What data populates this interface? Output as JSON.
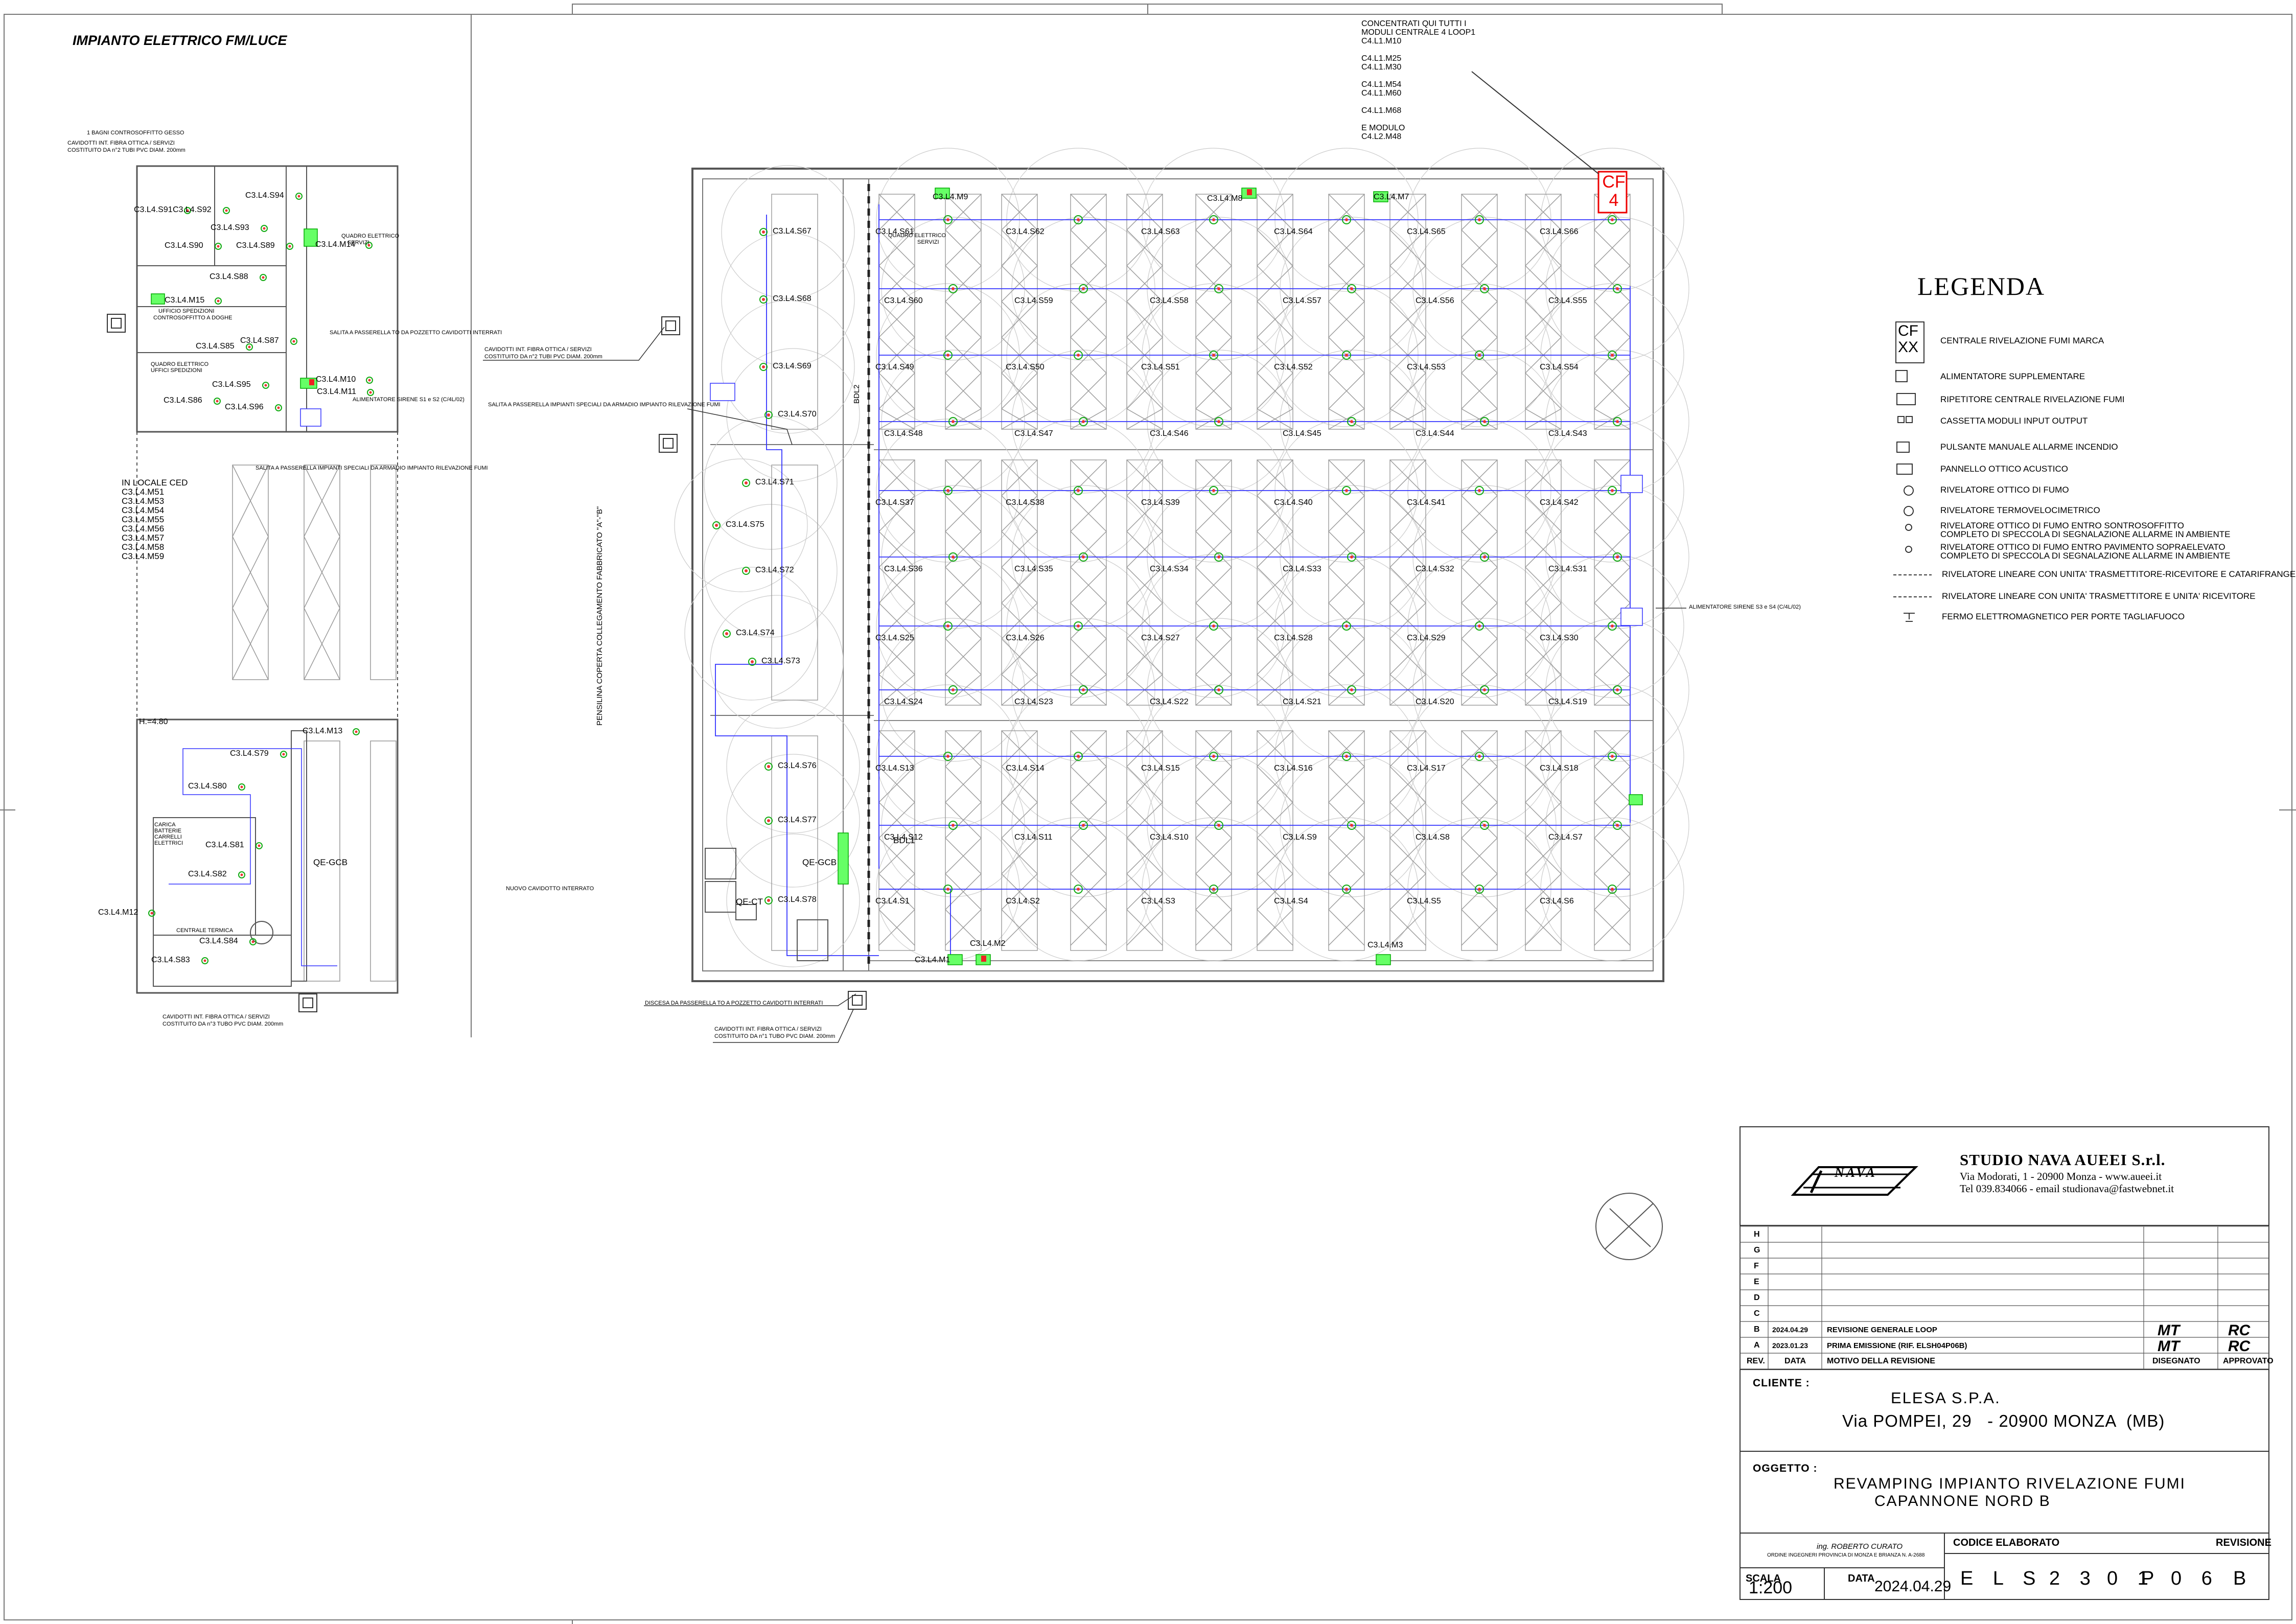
{
  "sheet_title": "IMPIANTO ELETTRICO FM/LUCE",
  "concentrator_note": [
    "CONCENTRATI QUI TUTTI I",
    "MODULI CENTRALE 4 LOOP1",
    "C4.L1.M10",
    "",
    "C4.L1.M25",
    "C4.L1.M30",
    "",
    "C4.L1.M54",
    "C4.L1.M60",
    "",
    "C4.L1.M68",
    "",
    "E MODULO",
    "C4.L2.M48"
  ],
  "central_box": {
    "line1": "CF",
    "line2": "4"
  },
  "left_notes": {
    "bagni": "1 BAGNI CONTROSOFFITTO GESSO",
    "cavidotti_top": [
      "CAVIDOTTI INT. FIBRA OTTICA / SERVIZI",
      "COSTITUITO DA n°2 TUBI PVC DIAM. 200mm"
    ],
    "ufficio_spedizioni": [
      "UFFICIO SPEDIZIONI",
      "CONTROSOFFITTO A DOGHE"
    ],
    "quadro_elettrico_uffici": [
      "QUADRO ELETTRICO",
      "UFFICI SPEDIZIONI"
    ],
    "quadro_elettrico_servizi": [
      "QUADRO ELETTRICO",
      "SERVIZI"
    ],
    "salita_cavidotti": "SALITA A PASSERELLA TO DA POZZETTO CAVIDOTTI INTERRATI",
    "alimentatore_sirene_1": "ALIMENTATORE SIRENE S1 e S2 (C/4L/02)",
    "salita_armadio": "SALITA A PASSERELLA IMPIANTI SPECIALI DA ARMADIO IMPIANTO RILEVAZIONE FUMI",
    "in_locale_ced": [
      "IN LOCALE CED",
      "C3.L4.M51",
      "C3.L4.M53",
      "C3.L4.M54",
      "C3.L4.M55",
      "C3.L4.M56",
      "C3.L4.M57",
      "C3.L4.M58",
      "C3.L4.M59"
    ],
    "height": "H.=4.80",
    "carica_batterie": [
      "CARICA",
      "BATTERIE",
      "CARRELLI",
      "ELETTRICI"
    ],
    "centrale_termica": "CENTRALE TERMICA",
    "cavidotti_bottom": [
      "CAVIDOTTI INT. FIBRA OTTICA / SERVIZI",
      "COSTITUITO DA n°3 TUBO PVC DIAM. 200mm"
    ],
    "qe_gcb_left": "QE-GCB"
  },
  "middle_notes": {
    "cavidotti_mid": [
      "CAVIDOTTI INT. FIBRA OTTICA / SERVIZI",
      "COSTITUITO DA n°2 TUBI PVC DIAM. 200mm"
    ],
    "salita_rilevazione": "SALITA A PASSERELLA IMPIANTI SPECIALI DA ARMADIO IMPIANTO RILEVAZIONE FUMI",
    "pensilina": "PENSILINA COPERTA COLLEGAMENTO FABBRICATO \"A\"-\"B\"",
    "nuovo_cavidotto": "NUOVO CAVIDOTTO INTERRATO",
    "discesa": "DISCESA DA PASSERELLA TO A POZZETTO CAVIDOTTI INTERRATI",
    "cavidotti_low": [
      "CAVIDOTTI INT. FIBRA OTTICA / SERVIZI",
      "COSTITUITO DA n°1 TUBO PVC DIAM. 200mm"
    ],
    "alimentatore_sirene_2": "ALIMENTATORE SIRENE S3 e S4 (C/4L/02)",
    "bdl1": "BDL1",
    "bdl2": "BDL2",
    "qe_gcb": "QE-GCB",
    "qe_ct": "QE-CT",
    "quadro_servizi": [
      "QUADRO ELETTRICO",
      "SERVIZI"
    ]
  },
  "left_labels": [
    "C3.L4.S91",
    "C3.L4.S92",
    "C3.L4.S94",
    "C3.L4.S93",
    "C3.L4.S90",
    "C3.L4.S89",
    "C3.L4.M14",
    "C3.L4.S88",
    "C3.L4.M15",
    "C3.L4.S87",
    "C3.L4.S85",
    "C3.L4.S95",
    "C3.L4.M10",
    "C3.L4.M11",
    "C3.L4.S86",
    "C3.L4.S96",
    "C3.L4.M13",
    "C3.L4.S79",
    "C3.L4.S80",
    "C3.L4.S81",
    "C3.L4.S82",
    "C3.L4.M12",
    "C3.L4.S84",
    "C3.L4.S83"
  ],
  "mid_labels": [
    "C3.L4.S67",
    "C3.L4.S68",
    "C3.L4.S69",
    "C3.L4.S70",
    "C3.L4.S71",
    "C3.L4.S75",
    "C3.L4.S72",
    "C3.L4.S74",
    "C3.L4.S73",
    "C3.L4.S76",
    "C3.L4.S77",
    "C3.L4.S78"
  ],
  "main_grid": {
    "row1": [
      "C3.L4.S61",
      "C3.L4.S62",
      "C3.L4.S63",
      "C3.L4.S64",
      "C3.L4.S65",
      "C3.L4.S66"
    ],
    "row2": [
      "C3.L4.S60",
      "C3.L4.S59",
      "C3.L4.S58",
      "C3.L4.S57",
      "C3.L4.S56",
      "C3.L4.S55"
    ],
    "row3": [
      "C3.L4.S49",
      "C3.L4.S50",
      "C3.L4.S51",
      "C3.L4.S52",
      "C3.L4.S53",
      "C3.L4.S54"
    ],
    "row4": [
      "C3.L4.S48",
      "C3.L4.S47",
      "C3.L4.S46",
      "C3.L4.S45",
      "C3.L4.S44",
      "C3.L4.S43"
    ],
    "row5": [
      "C3.L4.S37",
      "C3.L4.S38",
      "C3.L4.S39",
      "C3.L4.S40",
      "C3.L4.S41",
      "C3.L4.S42"
    ],
    "row6": [
      "C3.L4.S36",
      "C3.L4.S35",
      "C3.L4.S34",
      "C3.L4.S33",
      "C3.L4.S32",
      "C3.L4.S31"
    ],
    "row7": [
      "C3.L4.S25",
      "C3.L4.S26",
      "C3.L4.S27",
      "C3.L4.S28",
      "C3.L4.S29",
      "C3.L4.S30"
    ],
    "row8": [
      "C3.L4.S24",
      "C3.L4.S23",
      "C3.L4.S22",
      "C3.L4.S21",
      "C3.L4.S20",
      "C3.L4.S19"
    ],
    "row9": [
      "C3.L4.S13",
      "C3.L4.S14",
      "C3.L4.S15",
      "C3.L4.S16",
      "C3.L4.S17",
      "C3.L4.S18"
    ],
    "row10": [
      "C3.L4.S12",
      "C3.L4.S11",
      "C3.L4.S10",
      "C3.L4.S9",
      "C3.L4.S8",
      "C3.L4.S7"
    ],
    "row11": [
      "C3.L4.S1",
      "C3.L4.S2",
      "C3.L4.S3",
      "C3.L4.S4",
      "C3.L4.S5",
      "C3.L4.S6"
    ],
    "modules": {
      "m9": "C3.L4.M9",
      "m8": "C3.L4.M8",
      "m7": "C3.L4.M7",
      "m2": "C3.L4.M2",
      "m1": "C3.L4.M1",
      "m3": "C3.L4.M3"
    }
  },
  "legend": {
    "title": "LEGENDA",
    "items": [
      {
        "symbol": "CF XX",
        "text": "CENTRALE RIVELAZIONE FUMI MARCA"
      },
      {
        "symbol": "AL xxx",
        "text": "ALIMENTATORE SUPPLEMENTARE"
      },
      {
        "symbol": "LCD",
        "text": "RIPETITORE CENTRALE RIVELAZIONE FUMI"
      },
      {
        "symbol": "IO",
        "text": "CASSETTA MODULI INPUT OUTPUT"
      },
      {
        "symbol": "pulsante",
        "text": "PULSANTE MANUALE ALLARME INCENDIO"
      },
      {
        "symbol": "pannello",
        "text": "PANNELLO OTTICO ACUSTICO"
      },
      {
        "symbol": "ottico",
        "text": "RIVELATORE OTTICO DI FUMO"
      },
      {
        "symbol": "termo",
        "text": "RIVELATORE TERMOVELOCIMETRICO"
      },
      {
        "symbol": "sontro",
        "text": "RIVELATORE OTTICO DI FUMO ENTRO SONTROSOFFITTO\nCOMPLETO DI SPECCOLA DI SEGNALAZIONE ALLARME IN AMBIENTE"
      },
      {
        "symbol": "pav",
        "text": "RIVELATORE OTTICO DI FUMO ENTRO PAVIMENTO SOPRAELEVATO\nCOMPLETO DI SPECCOLA DI SEGNALAZIONE ALLARME IN AMBIENTE"
      },
      {
        "symbol": "lin1",
        "text": "RIVELATORE LINEARE CON UNITA' TRASMETTITORE-RICEVITORE E CATARIFRANGENTE"
      },
      {
        "symbol": "lin2",
        "text": "RIVELATORE LINEARE CON UNITA' TRASMETTITORE E UNITA' RICEVITORE"
      },
      {
        "symbol": "fermo",
        "text": "FERMO ELETTROMAGNETICO PER PORTE TAGLIAFUOCO"
      }
    ]
  },
  "title_block": {
    "company": "STUDIO NAVA AUEEI S.r.l.",
    "address": "Via Modorati, 1 - 20900 Monza - www.aueei.it",
    "contact": "Tel 039.834066 - email studionava@fastwebnet.it",
    "logo_text": "NAVA",
    "revisions": [
      {
        "rev": "H",
        "data": "",
        "motivo": "",
        "disegnato": "",
        "approvato": ""
      },
      {
        "rev": "G",
        "data": "",
        "motivo": "",
        "disegnato": "",
        "approvato": ""
      },
      {
        "rev": "F",
        "data": "",
        "motivo": "",
        "disegnato": "",
        "approvato": ""
      },
      {
        "rev": "E",
        "data": "",
        "motivo": "",
        "disegnato": "",
        "approvato": ""
      },
      {
        "rev": "D",
        "data": "",
        "motivo": "",
        "disegnato": "",
        "approvato": ""
      },
      {
        "rev": "C",
        "data": "",
        "motivo": "",
        "disegnato": "",
        "approvato": ""
      },
      {
        "rev": "B",
        "data": "2024.04.29",
        "motivo": "REVISIONE GENERALE LOOP",
        "disegnato": "MT",
        "approvato": "RC"
      },
      {
        "rev": "A",
        "data": "2023.01.23",
        "motivo": "PRIMA EMISSIONE (RIF. ELSH04P06B)",
        "disegnato": "MT",
        "approvato": "RC"
      }
    ],
    "headers": {
      "rev": "REV.",
      "data": "DATA",
      "motivo": "MOTIVO DELLA REVISIONE",
      "disegnato": "DISEGNATO",
      "approvato": "APPROVATO"
    },
    "cliente_label": "CLIENTE :",
    "cliente_name": "ELESA S.P.A.",
    "cliente_address": "Via POMPEI, 29   - 20900 MONZA  (MB)",
    "oggetto_label": "OGGETTO :",
    "oggetto_line1": "REVAMPING IMPIANTO RIVELAZIONE FUMI",
    "oggetto_line2": "CAPANNONE NORD B",
    "engineer": "ing. ROBERTO CURATO",
    "engineer_sub": "ORDINE INGEGNERI PROVINCIA DI MONZA E BRIANZA N. A-2688",
    "codice_label": "CODICE ELABORATO",
    "revisione_label": "REVISIONE",
    "scala_label": "SCALA",
    "scala_value": "1:200",
    "data_label": "DATA",
    "data_value": "2024.04.29",
    "codice_parts": [
      "E L S",
      "2 3",
      "0 1",
      "P",
      "0 6",
      "B"
    ]
  }
}
